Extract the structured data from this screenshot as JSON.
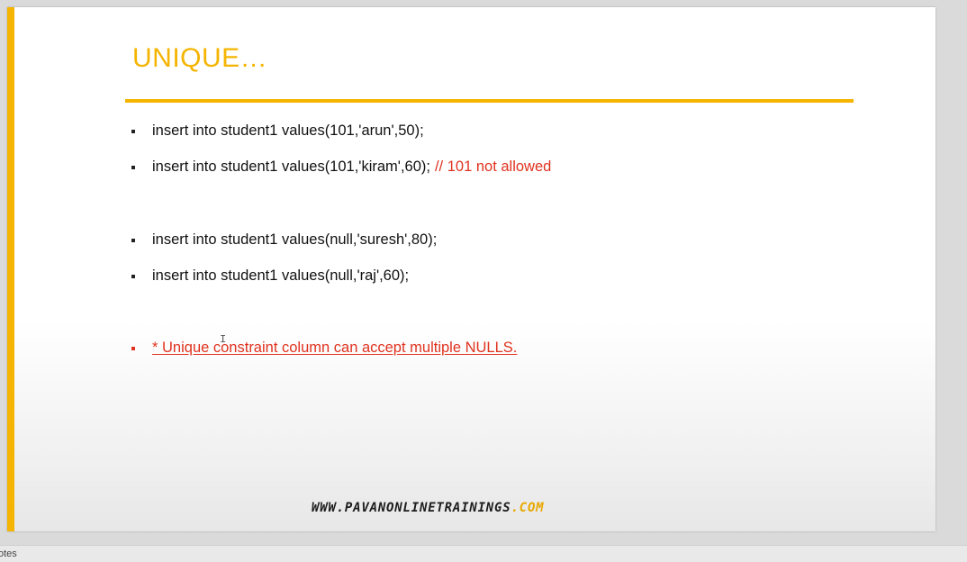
{
  "slide": {
    "title": "UNIQUE…",
    "bullets": [
      {
        "text": "insert into student1 values(101,'arun',50);",
        "comment": ""
      },
      {
        "text": "insert into student1 values(101,'kiram',60);",
        "comment": "// 101 not allowed"
      },
      {
        "text": "insert into student1 values(null,'suresh',80);",
        "comment": ""
      },
      {
        "text": "insert into student1 values(null,'raj',60);",
        "comment": ""
      }
    ],
    "note": "* Unique constraint column can accept multiple NULLS.",
    "footer": {
      "url_main": "WWW.PAVANONLINETRAININGS",
      "url_tld": ".COM"
    }
  },
  "status_bar": {
    "notes_label": "otes"
  },
  "colors": {
    "accent": "#f4b400",
    "comment_red": "#e0321f",
    "text": "#111111"
  },
  "icons": {
    "cursor": "text-cursor-icon"
  }
}
